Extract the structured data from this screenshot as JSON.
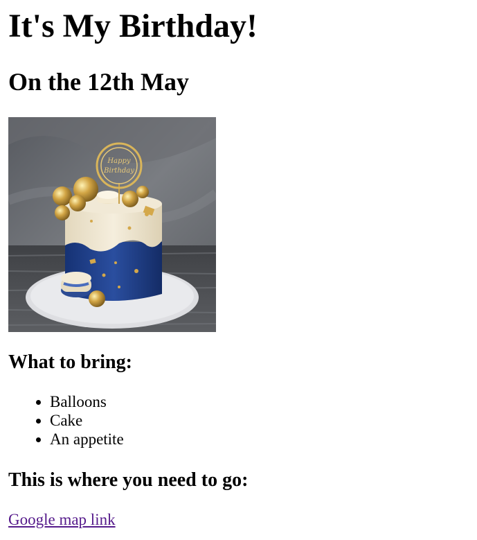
{
  "page": {
    "title": "It's My Birthday!",
    "date_heading": "On the 12th May",
    "bring_heading": "What to bring:",
    "bring_items": [
      "Balloons",
      "Cake",
      "An appetite"
    ],
    "where_heading": "This is where you need to go:",
    "map_link_label": "Google map link"
  },
  "image": {
    "subject": "birthday-cake-photo",
    "topper_text": "Happy Birthday"
  },
  "colors": {
    "text": "#000000",
    "visited_link": "#551a8b",
    "background": "#ffffff",
    "cake_blue": "#1f3f86",
    "cake_cream": "#efe6cf",
    "gold": "#c9a14a",
    "backdrop_gray": "#6d6f73"
  }
}
